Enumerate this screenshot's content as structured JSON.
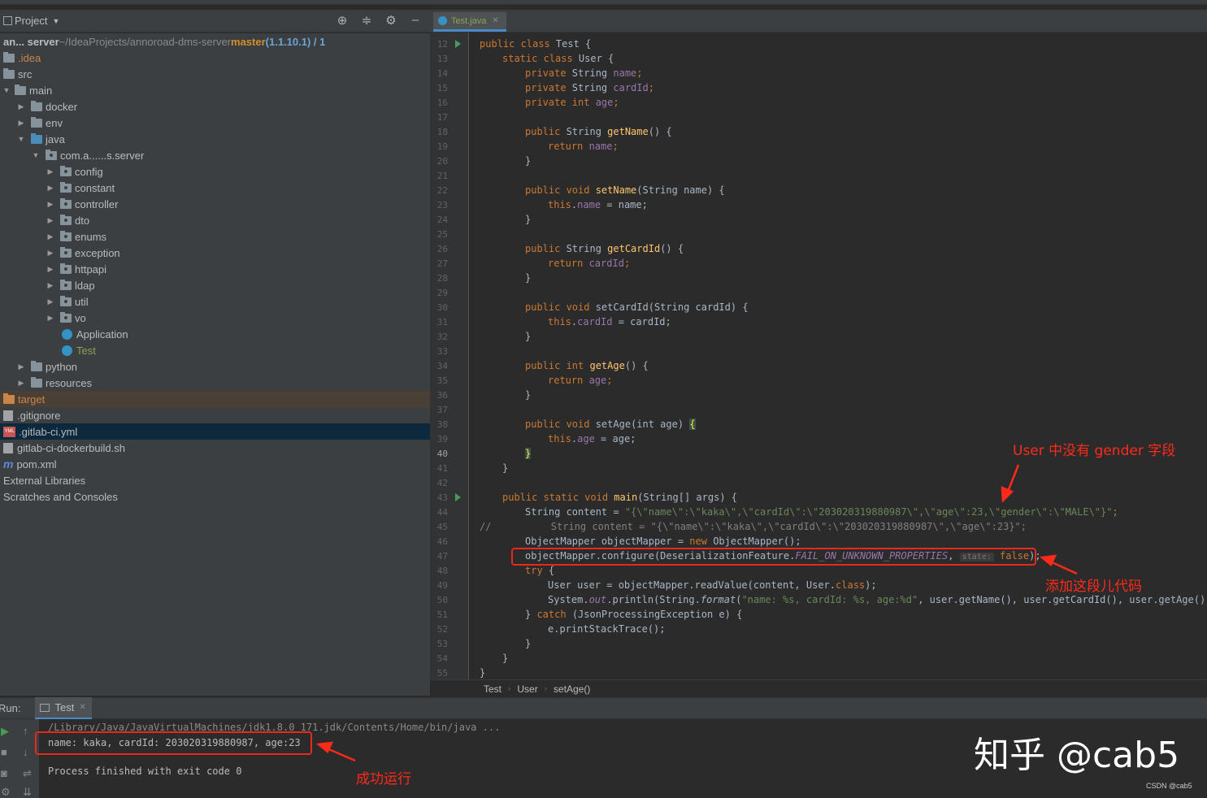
{
  "project_panel": {
    "title": "Project",
    "root_line": {
      "name": "an... server",
      "path": " ~/IdeaProjects/annoroad-dms-server ",
      "branch": "master",
      "version": " (1.1.10.1) / 1"
    },
    "items": [
      {
        "label": ".idea"
      },
      {
        "label": "src"
      },
      {
        "label": "main"
      },
      {
        "label": "docker"
      },
      {
        "label": "env"
      },
      {
        "label": "java"
      },
      {
        "label": "com.a......s.server"
      },
      {
        "label": "config"
      },
      {
        "label": "constant"
      },
      {
        "label": "controller"
      },
      {
        "label": "dto"
      },
      {
        "label": "enums"
      },
      {
        "label": "exception"
      },
      {
        "label": "httpapi"
      },
      {
        "label": "ldap"
      },
      {
        "label": "util"
      },
      {
        "label": "vo"
      },
      {
        "label": "Application"
      },
      {
        "label": "Test"
      },
      {
        "label": "python"
      },
      {
        "label": "resources"
      },
      {
        "label": "target"
      },
      {
        "label": ".gitignore"
      },
      {
        "label": ".gitlab-ci.yml"
      },
      {
        "label": "gitlab-ci-dockerbuild.sh"
      },
      {
        "label": "pom.xml"
      },
      {
        "label": "External Libraries"
      },
      {
        "label": "Scratches and Consoles"
      }
    ]
  },
  "editor": {
    "tab": "Test.java",
    "line_numbers": [
      "12",
      "13",
      "14",
      "15",
      "16",
      "17",
      "18",
      "19",
      "20",
      "21",
      "22",
      "23",
      "24",
      "25",
      "26",
      "27",
      "28",
      "29",
      "30",
      "31",
      "32",
      "33",
      "34",
      "35",
      "36",
      "37",
      "38",
      "39",
      "40",
      "41",
      "42",
      "43",
      "44",
      "45",
      "46",
      "47",
      "48",
      "49",
      "50",
      "51",
      "52",
      "53",
      "54",
      "55"
    ],
    "code": {
      "l12": {
        "a": "public class ",
        "b": "Test {"
      },
      "l13": {
        "a": "static class ",
        "b": "User {"
      },
      "l14": {
        "a": "private ",
        "b": "String ",
        "c": "name",
        "d": ";"
      },
      "l15": {
        "a": "private ",
        "b": "String ",
        "c": "cardId",
        "d": ";"
      },
      "l16": {
        "a": "private int ",
        "c": "age",
        "d": ";"
      },
      "l18": {
        "a": "public ",
        "b": "String ",
        "c": "getName",
        "d": "() {"
      },
      "l19": {
        "a": "return ",
        "c": "name",
        "d": ";"
      },
      "l20": {
        "a": "}"
      },
      "l22": {
        "a": "public void ",
        "c": "setName",
        "d": "(String name) {"
      },
      "l23": {
        "a": "this",
        "b": ".",
        "c": "name",
        "d": " = name;"
      },
      "l24": {
        "a": "}"
      },
      "l26": {
        "a": "public ",
        "b": "String ",
        "c": "getCardId",
        "d": "() {"
      },
      "l27": {
        "a": "return ",
        "c": "cardId",
        "d": ";"
      },
      "l28": {
        "a": "}"
      },
      "l30": {
        "a": "public void ",
        "c": "setCardId",
        "d": "(String cardId) {"
      },
      "l31": {
        "a": "this",
        "b": ".",
        "c": "cardId",
        "d": " = cardId;"
      },
      "l32": {
        "a": "}"
      },
      "l34": {
        "a": "public int ",
        "c": "getAge",
        "d": "() {"
      },
      "l35": {
        "a": "return ",
        "c": "age",
        "d": ";"
      },
      "l36": {
        "a": "}"
      },
      "l38": {
        "a": "public void ",
        "c": "setAge",
        "d": "(int age) ",
        "e": "{"
      },
      "l39": {
        "a": "this",
        "b": ".",
        "c": "age",
        "d": " = age;"
      },
      "l40": {
        "a": "}"
      },
      "l41": {
        "a": "}"
      },
      "l43": {
        "a": "public static void ",
        "c": "main",
        "d": "(String[] args) {"
      },
      "l44": {
        "a": "String content = ",
        "b": "\"{\\\"name\\\":\\\"kaka\\\",\\\"cardId\\\":\\\"203020319880987\\\",\\\"age\\\":23,\\\"gender\\\":\\\"MALE\\\"}\"",
        "c": ";"
      },
      "l45": {
        "a": "//",
        "b": "      String content = \"{\\\"name\\\":\\\"kaka\\\",\\\"cardId\\\":\\\"203020319880987\\\",\\\"age\\\":23}\";"
      },
      "l46": {
        "a": "ObjectMapper objectMapper = ",
        "b": "new ",
        "c": "ObjectMapper();"
      },
      "l47": {
        "a": "objectMapper.configure(DeserializationFeature.",
        "b": "FAIL_ON_UNKNOWN_PROPERTIES",
        "c": ", ",
        "hint": "state:",
        "d": " false",
        "e": ");"
      },
      "l48": {
        "a": "try ",
        "b": "{"
      },
      "l49": {
        "a": "User user = objectMapper.readValue(content, User.",
        "b": "class",
        "c": ");"
      },
      "l50": {
        "a": "System.",
        "b": "out",
        "c": ".println(String.",
        "d": "format",
        "e": "(",
        "f": "\"name: %s, cardId: %s, age:%d\"",
        "g": ", user.getName(), user.getCardId(), user.getAge()));"
      },
      "l51": {
        "a": "} ",
        "b": "catch ",
        "c": "(JsonProcessingException e) {"
      },
      "l52": {
        "a": "e.printStackTrace();"
      },
      "l53": {
        "a": "}"
      },
      "l54": {
        "a": "}"
      },
      "l55": {
        "a": "}"
      }
    }
  },
  "breadcrumbs": [
    "Test",
    "User",
    "setAge()"
  ],
  "run_panel": {
    "label": "Run:",
    "tab": "Test",
    "lines": [
      "/Library/Java/JavaVirtualMachines/jdk1.8.0_171.jdk/Contents/Home/bin/java ...",
      "name: kaka, cardId: 203020319880987, age:23",
      "Process finished with exit code 0"
    ]
  },
  "annotations": {
    "no_gender": "User 中没有 gender 字段",
    "add_code": "添加这段儿代码",
    "success": "成功运行"
  },
  "watermark": "知乎 @cab5",
  "credit": "CSDN @cab5",
  "colors": {
    "annotation_red": "#e8291d",
    "keyword": "#cc7832",
    "field": "#9876aa",
    "string": "#6a8759",
    "method": "#ffc66d"
  }
}
